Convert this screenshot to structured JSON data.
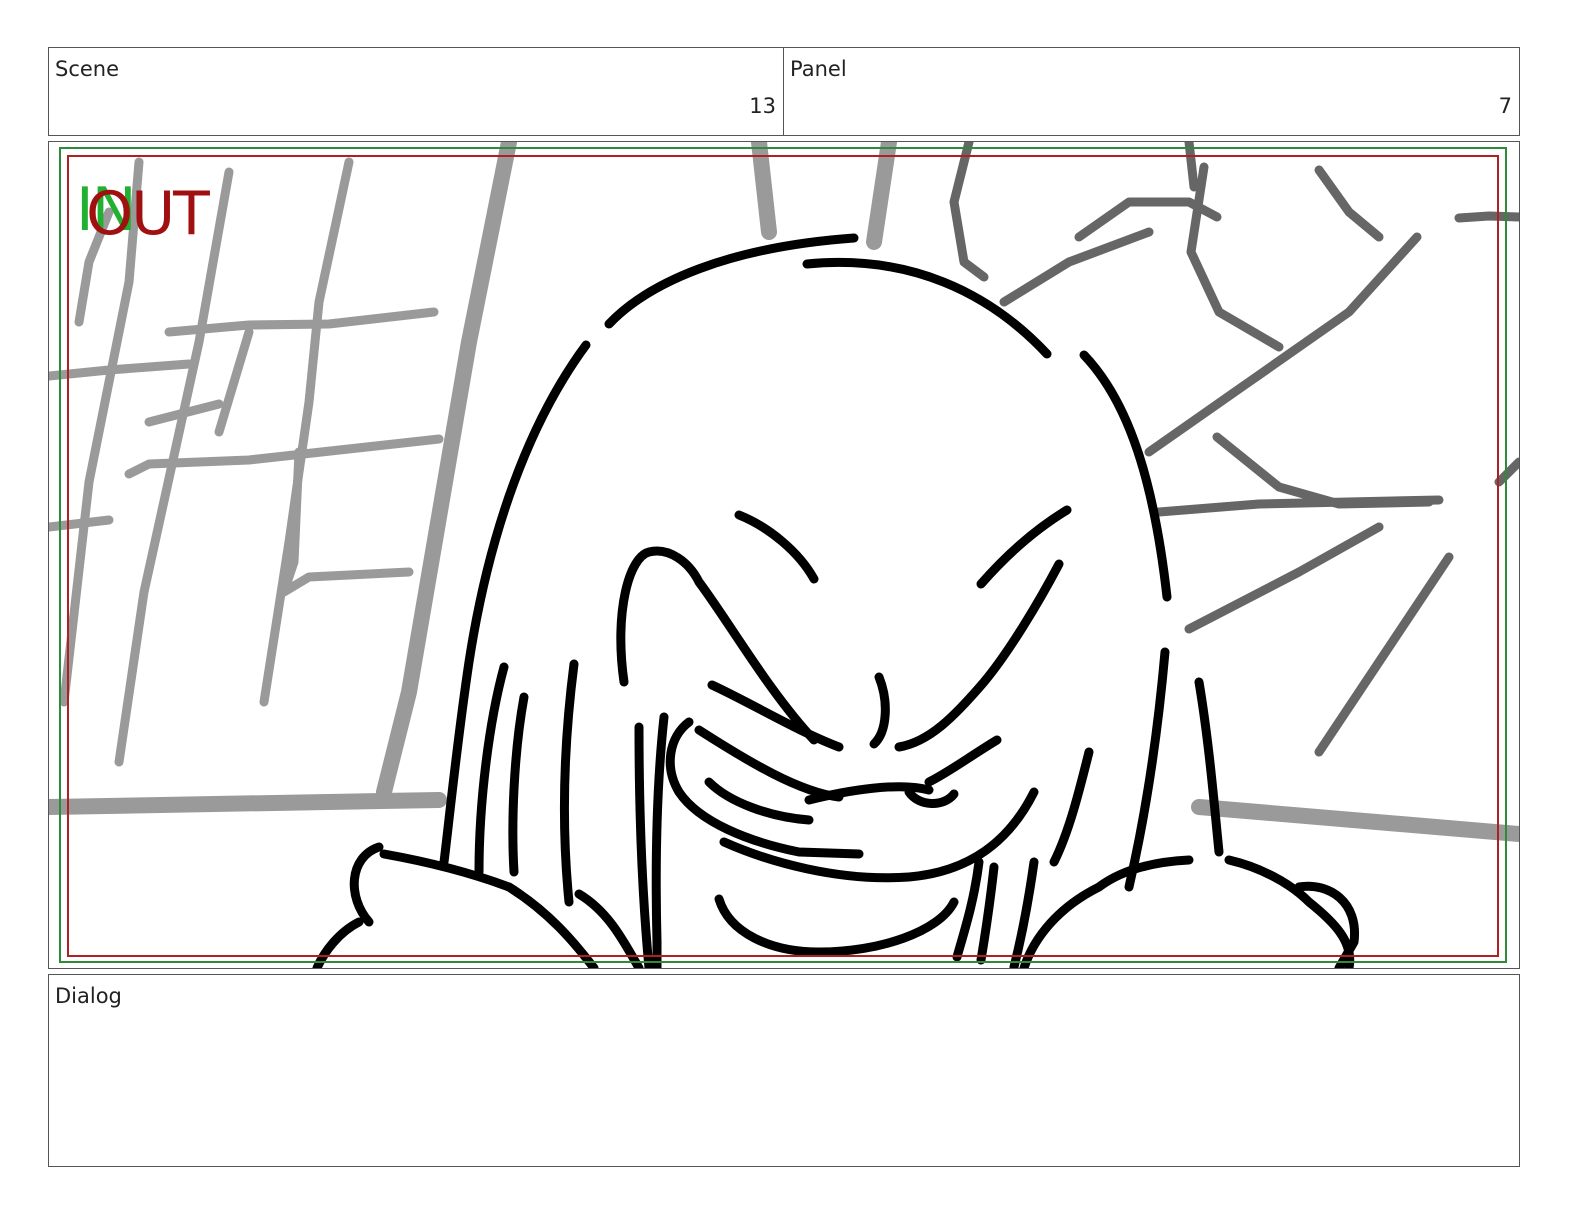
{
  "scene": {
    "label": "Scene",
    "value": "13"
  },
  "panel": {
    "label": "Panel",
    "value": "7"
  },
  "frame": {
    "in_marker": "IN",
    "out_marker": "OUT",
    "colors": {
      "in_marker": "#22b030",
      "out_marker": "#a01010",
      "safe_area": "#2e8b3a",
      "title_safe": "#b02020"
    },
    "drawing": "sketch-image"
  },
  "dialog": {
    "label": "Dialog",
    "text": ""
  }
}
